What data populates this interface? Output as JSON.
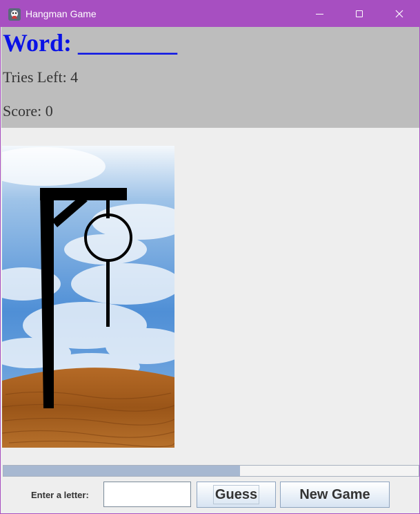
{
  "window": {
    "title": "Hangman Game",
    "controls": {
      "minimize": "minimize",
      "maximize": "maximize",
      "close": "close"
    }
  },
  "header": {
    "word_label": "Word: ________",
    "tries_label": "Tries Left: 4",
    "score_label": "Score: 0"
  },
  "progress": {
    "fraction": 0.57
  },
  "controls": {
    "enter_label": "Enter a letter:",
    "letter_value": "",
    "guess_label": "Guess",
    "new_game_label": "New Game"
  },
  "colors": {
    "titlebar": "#a74fc1",
    "word": "#0a12e6",
    "header_bg": "#bdbdbd",
    "body_bg": "#eeeeee"
  },
  "icons": [
    "app-icon",
    "minimize-icon",
    "maximize-icon",
    "close-icon"
  ]
}
